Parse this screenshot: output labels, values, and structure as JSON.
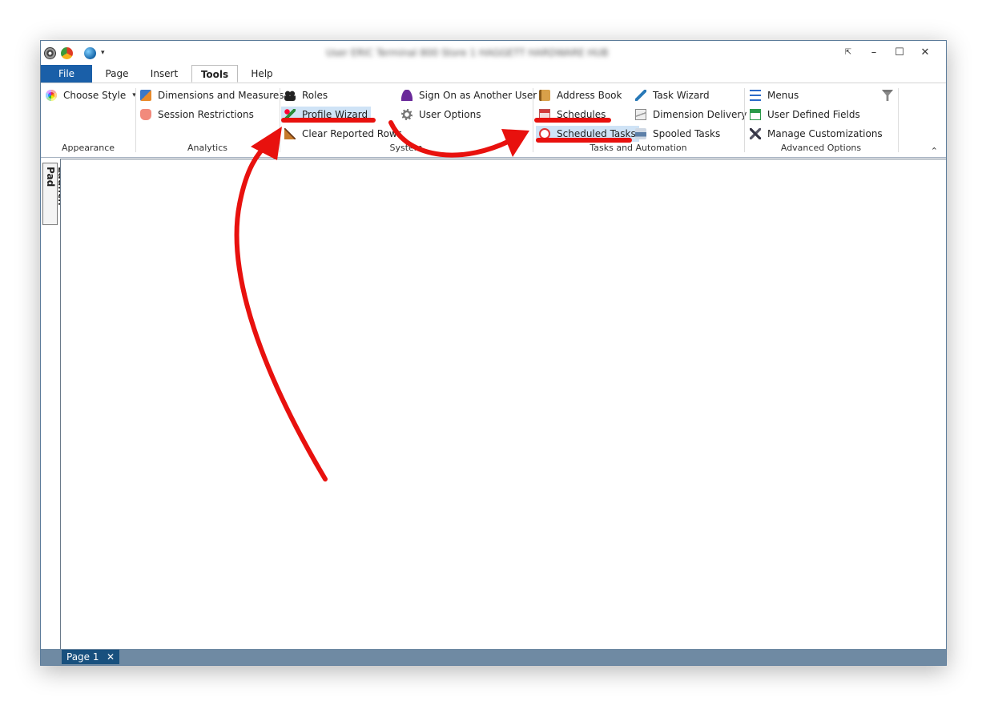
{
  "window": {
    "title": "User ERIC Terminal 800 Store 1 HAGGETT HARDWARE HUB",
    "controls": {
      "pin": "⇱",
      "minimize": "–",
      "maximize": "☐",
      "close": "✕"
    }
  },
  "qat": {
    "dropdown": "▾"
  },
  "tabs": {
    "file": "File",
    "page": "Page",
    "insert": "Insert",
    "tools": "Tools",
    "help": "Help"
  },
  "ribbon": {
    "appearance": {
      "label": "Appearance",
      "choose_style": "Choose Style",
      "dropdown": "▾"
    },
    "analytics": {
      "label": "Analytics",
      "dimensions": "Dimensions and Measures",
      "session": "Session Restrictions"
    },
    "system": {
      "label": "System",
      "roles": "Roles",
      "profile_wizard": "Profile Wizard",
      "clear_rows": "Clear Reported Rows",
      "sign_on": "Sign On as Another User",
      "user_options": "User Options"
    },
    "tasks": {
      "label": "Tasks and Automation",
      "address_book": "Address Book",
      "schedules": "Schedules",
      "scheduled_tasks": "Scheduled Tasks",
      "task_wizard": "Task Wizard",
      "dimension_delivery": "Dimension Delivery",
      "spooled_tasks": "Spooled Tasks"
    },
    "advanced": {
      "label": "Advanced Options",
      "menus": "Menus",
      "udf": "User Defined Fields",
      "manage": "Manage Customizations"
    },
    "collapse": "⌃"
  },
  "sidebar": {
    "launch_pad": "Launch Pad"
  },
  "bottom": {
    "page_tab": "Page 1",
    "close": "✕"
  },
  "colors": {
    "file_tab": "#1a5fa8",
    "highlight": "#cfe3f6",
    "annotation": "#e8110e",
    "page_tab": "#18507e",
    "bottom_bar": "#6f8aa3"
  }
}
